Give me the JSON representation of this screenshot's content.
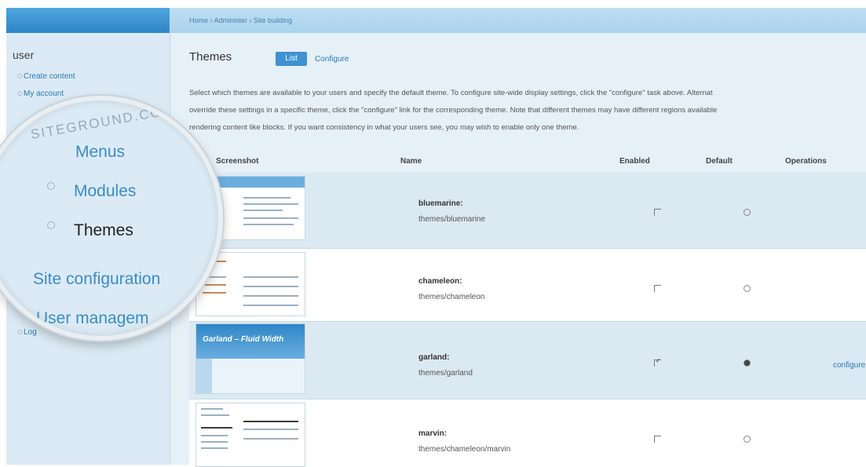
{
  "breadcrumb": "Home › Administer › Site building",
  "sidebar": {
    "title": "user",
    "links": [
      "Create content",
      "My account"
    ],
    "tail_link": "Log"
  },
  "page": {
    "title": "Themes",
    "tabs": [
      {
        "label": "List",
        "active": true
      },
      {
        "label": "Configure",
        "active": false
      }
    ],
    "description": [
      "Select which themes are available to your users and specify the default theme. To configure site-wide display settings, click the \"configure\" task above. Alternat",
      "override these settings in a specific theme, click the \"configure\" link for the corresponding theme. Note that different themes may have different regions available",
      "rendering content like blocks. If you want consistency in what your users see, you may wish to enable only one theme."
    ]
  },
  "table": {
    "headers": [
      "Screenshot",
      "Name",
      "Enabled",
      "Default",
      "Operations"
    ],
    "rows": [
      {
        "name": "bluemarine:",
        "path": "themes/bluemarine",
        "enabled": false,
        "default": false,
        "operation": ""
      },
      {
        "name": "chameleon:",
        "path": "themes/chameleon",
        "enabled": false,
        "default": false,
        "operation": ""
      },
      {
        "name": "garland:",
        "path": "themes/garland",
        "enabled": true,
        "default": true,
        "operation": "configure"
      },
      {
        "name": "marvin:",
        "path": "themes/chameleon/marvin",
        "enabled": false,
        "default": false,
        "operation": ""
      }
    ],
    "garland_banner": "Garland – Fluid Width"
  },
  "magnifier": {
    "watermark": "SITEGROUND.COM",
    "items": [
      {
        "label": "Menus",
        "bullet": false
      },
      {
        "label": "Modules",
        "bullet": true
      },
      {
        "label": "Themes",
        "bullet": true
      },
      {
        "label": "Site configuration",
        "bullet": false
      },
      {
        "label": "User managem",
        "bullet": false
      }
    ]
  },
  "colors": {
    "accent": "#3f91d0",
    "link": "#2a7ab8",
    "sidebar_bg": "#dbeaf4"
  }
}
